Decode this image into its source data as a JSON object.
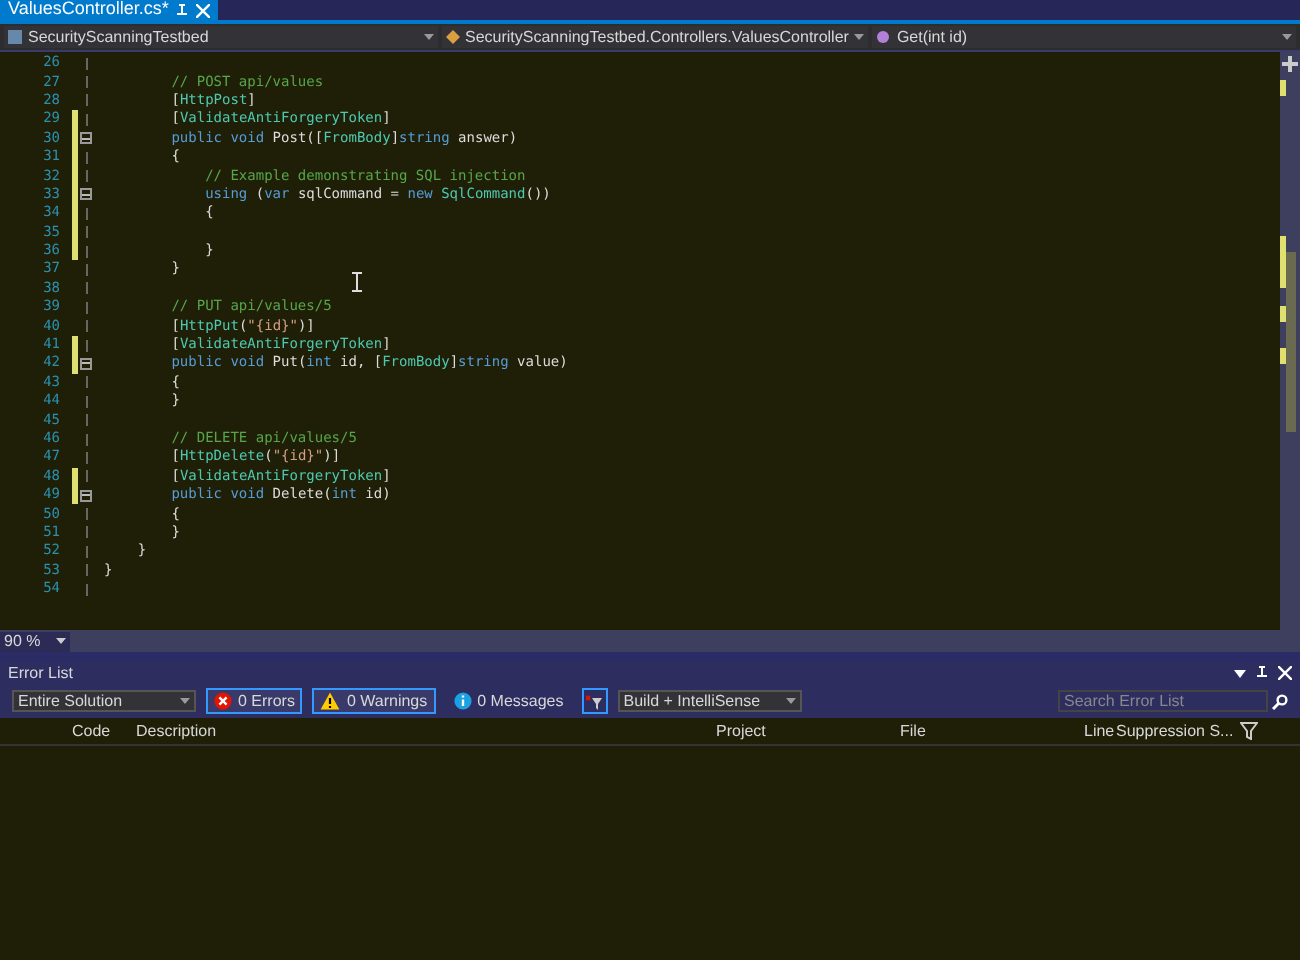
{
  "document_tab": {
    "title": "ValuesController.cs*",
    "selected": true
  },
  "nav_bar": [
    "SecurityScanningTestbed",
    "SecurityScanningTestbed.Controllers.ValuesController",
    "Get(int id)"
  ],
  "editor": {
    "lines": [
      {
        "number": "26",
        "modified": false,
        "fold": false
      },
      {
        "number": "27",
        "modified": false,
        "fold": false,
        "tokens": [
          {
            "t": "        // POST api/values",
            "kind": "comment"
          }
        ]
      },
      {
        "number": "28",
        "modified": false,
        "fold": false,
        "tokens": [
          {
            "t": "        [",
            "kind": "plain"
          },
          {
            "t": "HttpPost",
            "kind": "type"
          },
          {
            "t": "]",
            "kind": "plain"
          }
        ]
      },
      {
        "number": "29",
        "modified": true,
        "fold": false,
        "tokens": [
          {
            "t": "        [",
            "kind": "plain"
          },
          {
            "t": "ValidateAntiForgeryToken",
            "kind": "type"
          },
          {
            "t": "]",
            "kind": "plain"
          }
        ]
      },
      {
        "number": "30",
        "modified": true,
        "fold": true,
        "tokens": [
          {
            "t": "        public void ",
            "kind": "keyword"
          },
          {
            "t": "Post([",
            "kind": "plain"
          },
          {
            "t": "FromBody",
            "kind": "type"
          },
          {
            "t": "]",
            "kind": "plain"
          },
          {
            "t": "string ",
            "kind": "keyword"
          },
          {
            "t": "answer)",
            "kind": "plain"
          }
        ]
      },
      {
        "number": "31",
        "modified": true,
        "fold": false,
        "tokens": [
          {
            "t": "        {",
            "kind": "plain"
          }
        ]
      },
      {
        "number": "32",
        "modified": true,
        "fold": false,
        "tokens": [
          {
            "t": "            // Example demonstrating SQL injection",
            "kind": "comment"
          }
        ]
      },
      {
        "number": "33",
        "modified": true,
        "fold": true,
        "tokens": [
          {
            "t": "            using ",
            "kind": "keyword"
          },
          {
            "t": "(",
            "kind": "plain"
          },
          {
            "t": "var ",
            "kind": "keyword"
          },
          {
            "t": "sqlCommand = ",
            "kind": "plain"
          },
          {
            "t": "new ",
            "kind": "keyword"
          },
          {
            "t": "SqlCommand",
            "kind": "type"
          },
          {
            "t": "())",
            "kind": "plain"
          }
        ]
      },
      {
        "number": "34",
        "modified": true,
        "fold": false,
        "tokens": [
          {
            "t": "            {",
            "kind": "plain"
          }
        ]
      },
      {
        "number": "35",
        "modified": true,
        "fold": false
      },
      {
        "number": "36",
        "modified": true,
        "fold": false,
        "tokens": [
          {
            "t": "            }",
            "kind": "plain"
          }
        ]
      },
      {
        "number": "37",
        "modified": false,
        "fold": false,
        "tokens": [
          {
            "t": "        }",
            "kind": "plain"
          }
        ]
      },
      {
        "number": "38",
        "modified": false,
        "fold": false
      },
      {
        "number": "39",
        "modified": false,
        "fold": false,
        "tokens": [
          {
            "t": "        // PUT api/values/5",
            "kind": "comment"
          }
        ]
      },
      {
        "number": "40",
        "modified": false,
        "fold": false,
        "tokens": [
          {
            "t": "        [",
            "kind": "plain"
          },
          {
            "t": "HttpPut",
            "kind": "type"
          },
          {
            "t": "(",
            "kind": "plain"
          },
          {
            "t": "\"{id}\"",
            "kind": "string"
          },
          {
            "t": ")]",
            "kind": "plain"
          }
        ]
      },
      {
        "number": "41",
        "modified": true,
        "fold": false,
        "tokens": [
          {
            "t": "        [",
            "kind": "plain"
          },
          {
            "t": "ValidateAntiForgeryToken",
            "kind": "type"
          },
          {
            "t": "]",
            "kind": "plain"
          }
        ]
      },
      {
        "number": "42",
        "modified": true,
        "fold": true,
        "tokens": [
          {
            "t": "        public void ",
            "kind": "keyword"
          },
          {
            "t": "Put(",
            "kind": "plain"
          },
          {
            "t": "int ",
            "kind": "keyword"
          },
          {
            "t": "id, [",
            "kind": "plain"
          },
          {
            "t": "FromBody",
            "kind": "type"
          },
          {
            "t": "]",
            "kind": "plain"
          },
          {
            "t": "string ",
            "kind": "keyword"
          },
          {
            "t": "value)",
            "kind": "plain"
          }
        ]
      },
      {
        "number": "43",
        "modified": false,
        "fold": false,
        "tokens": [
          {
            "t": "        {",
            "kind": "plain"
          }
        ]
      },
      {
        "number": "44",
        "modified": false,
        "fold": false,
        "tokens": [
          {
            "t": "        }",
            "kind": "plain"
          }
        ]
      },
      {
        "number": "45",
        "modified": false,
        "fold": false
      },
      {
        "number": "46",
        "modified": false,
        "fold": false,
        "tokens": [
          {
            "t": "        // DELETE api/values/5",
            "kind": "comment"
          }
        ]
      },
      {
        "number": "47",
        "modified": false,
        "fold": false,
        "tokens": [
          {
            "t": "        [",
            "kind": "plain"
          },
          {
            "t": "HttpDelete",
            "kind": "type"
          },
          {
            "t": "(",
            "kind": "plain"
          },
          {
            "t": "\"{id}\"",
            "kind": "string"
          },
          {
            "t": ")]",
            "kind": "plain"
          }
        ]
      },
      {
        "number": "48",
        "modified": true,
        "fold": false,
        "tokens": [
          {
            "t": "        [",
            "kind": "plain"
          },
          {
            "t": "ValidateAntiForgeryToken",
            "kind": "type"
          },
          {
            "t": "]",
            "kind": "plain"
          }
        ]
      },
      {
        "number": "49",
        "modified": true,
        "fold": true,
        "tokens": [
          {
            "t": "        public void ",
            "kind": "keyword"
          },
          {
            "t": "Delete(",
            "kind": "plain"
          },
          {
            "t": "int ",
            "kind": "keyword"
          },
          {
            "t": "id)",
            "kind": "plain"
          }
        ]
      },
      {
        "number": "50",
        "modified": false,
        "fold": false,
        "tokens": [
          {
            "t": "        {",
            "kind": "plain"
          }
        ]
      },
      {
        "number": "51",
        "modified": false,
        "fold": false,
        "tokens": [
          {
            "t": "        }",
            "kind": "plain"
          }
        ]
      },
      {
        "number": "52",
        "modified": false,
        "fold": false,
        "tokens": [
          {
            "t": "    }",
            "kind": "plain"
          }
        ]
      },
      {
        "number": "53",
        "modified": false,
        "fold": false,
        "tokens": [
          {
            "t": "}",
            "kind": "plain"
          }
        ]
      },
      {
        "number": "54",
        "modified": false,
        "fold": false
      }
    ],
    "zoom": "90 %"
  },
  "error_list": {
    "title": "Error List",
    "scope": "Entire Solution",
    "filters": [
      {
        "label": "0 Errors",
        "kind": "error",
        "selected": true
      },
      {
        "label": "0 Warnings",
        "kind": "warning",
        "selected": true
      },
      {
        "label": "0 Messages",
        "kind": "info",
        "selected": false
      }
    ],
    "source": "Build + IntelliSense",
    "search": {
      "placeholder": "Search Error List"
    },
    "columns": [
      "Code",
      "Description",
      "Project",
      "File",
      "Line",
      "Suppression S..."
    ]
  }
}
